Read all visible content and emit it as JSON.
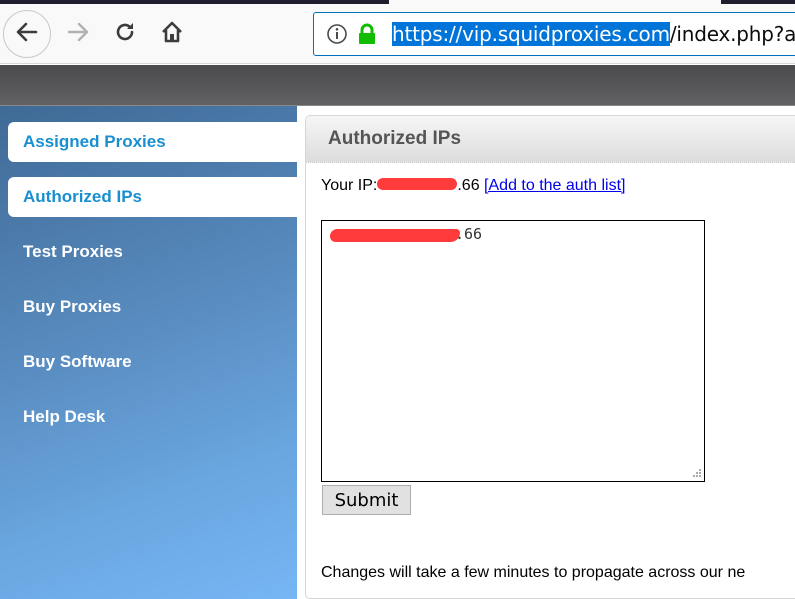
{
  "browser": {
    "url_selected": "https://vip.squidproxies.com",
    "url_rest": "/index.php?a",
    "icons": {
      "back": "arrow-left-icon",
      "forward": "arrow-right-icon",
      "reload": "reload-icon",
      "home": "home-icon",
      "info": "info-icon",
      "lock": "lock-icon"
    },
    "lock_color": "#12bc00"
  },
  "sidebar": {
    "items": [
      {
        "label": "Assigned Proxies",
        "boxed": true
      },
      {
        "label": "Authorized IPs",
        "boxed": true,
        "active": true
      },
      {
        "label": "Test Proxies",
        "boxed": false
      },
      {
        "label": "Buy Proxies",
        "boxed": false
      },
      {
        "label": "Buy Software",
        "boxed": false
      },
      {
        "label": "Help Desk",
        "boxed": false
      }
    ]
  },
  "main": {
    "title": "Authorized IPs",
    "your_ip_label": "Your IP:",
    "your_ip_visible_suffix": ".66",
    "add_link": "[Add to the auth list]",
    "textarea_visible_suffix": ".66",
    "submit_label": "Submit",
    "note": "Changes will take a few minutes to propagate across our ne"
  },
  "colors": {
    "link": "#0000ee",
    "sidebar_active_text": "#1a8fd0",
    "redaction": "#ff3b3b"
  }
}
